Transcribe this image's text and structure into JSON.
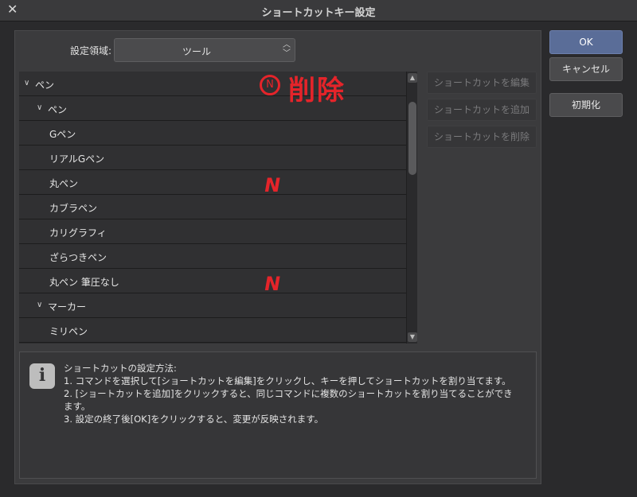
{
  "window": {
    "title": "ショートカットキー設定"
  },
  "settings_area": {
    "label": "設定領域:",
    "value": "ツール"
  },
  "tree": {
    "rows": [
      {
        "label": "ペン",
        "level": 0,
        "expanded": true
      },
      {
        "label": "ペン",
        "level": 1,
        "expanded": true
      },
      {
        "label": "Gペン",
        "level": 2
      },
      {
        "label": "リアルGペン",
        "level": 2
      },
      {
        "label": "丸ペン",
        "level": 2
      },
      {
        "label": "カブラペン",
        "level": 2
      },
      {
        "label": "カリグラフィ",
        "level": 2
      },
      {
        "label": "ざらつきペン",
        "level": 2
      },
      {
        "label": "丸ペン 筆圧なし",
        "level": 2
      },
      {
        "label": "マーカー",
        "level": 1,
        "expanded": true
      },
      {
        "label": "ミリペン",
        "level": 2
      }
    ]
  },
  "side_buttons": {
    "edit": "ショートカットを編集",
    "add": "ショートカットを追加",
    "delete": "ショートカットを削除"
  },
  "dialog_buttons": {
    "ok": "OK",
    "cancel": "キャンセル",
    "reset": "初期化"
  },
  "help": {
    "lines": [
      "ショートカットの設定方法:",
      "1. コマンドを選択して[ショートカットを編集]をクリックし、キーを押してショートカットを割り当てます。",
      "2. [ショートカットを追加]をクリックすると、同じコマンドに複数のショートカットを割り当てることができ",
      "ます。",
      "3. 設定の終了後[OK]をクリックすると、変更が反映されます。"
    ]
  },
  "annotations": {
    "circled_letter": "N",
    "delete_note": "削除",
    "marks": [
      "N",
      "N"
    ],
    "color": "#e5242a"
  },
  "colors": {
    "ok_button": "#5a6d98",
    "background": "#2a2a2c",
    "annotation": "#e5242a"
  }
}
